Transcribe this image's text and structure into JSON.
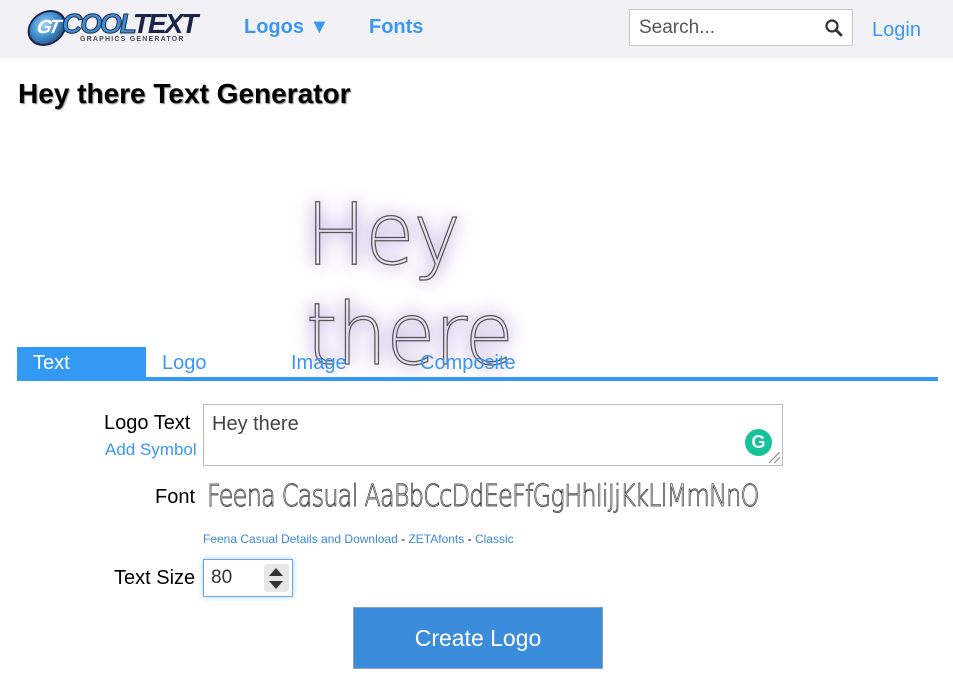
{
  "header": {
    "logo": {
      "main_cool": "COOL",
      "main_text": "TEXT",
      "subtitle": "GRAPHICS GENERATOR",
      "badge": "GT"
    },
    "nav": [
      {
        "label": "Logos ▼"
      },
      {
        "label": "Fonts"
      }
    ],
    "search": {
      "placeholder": "Search...",
      "value": ""
    },
    "login_label": "Login"
  },
  "page_title": "Hey there Text Generator",
  "preview": {
    "text": "Hey there",
    "glow_color": "#c9b8e3"
  },
  "tabs": [
    {
      "label": "Text",
      "active": true
    },
    {
      "label": "Logo",
      "active": false
    },
    {
      "label": "Image",
      "active": false
    },
    {
      "label": "Composite",
      "active": false
    }
  ],
  "form": {
    "logo_text_label": "Logo Text",
    "add_symbol_label": "Add Symbol",
    "logo_text_value": "Hey there",
    "font_label": "Font",
    "font_sample": "Feena Casual AaBbCcDdEeFfGgHhIiJjKkLlMmNnO",
    "font_links": {
      "details": "Feena Casual Details and Download",
      "sep1": " - ",
      "foundry": "ZETAfonts",
      "sep2": " - ",
      "category": "Classic"
    },
    "text_size_label": "Text Size",
    "text_size_value": "80",
    "create_button": "Create Logo"
  },
  "colors": {
    "accent": "#3399f3",
    "link": "#3a97f2",
    "button": "#3b8ddb",
    "header_bg": "#f2f2f6",
    "grammarly": "#15c39a"
  }
}
